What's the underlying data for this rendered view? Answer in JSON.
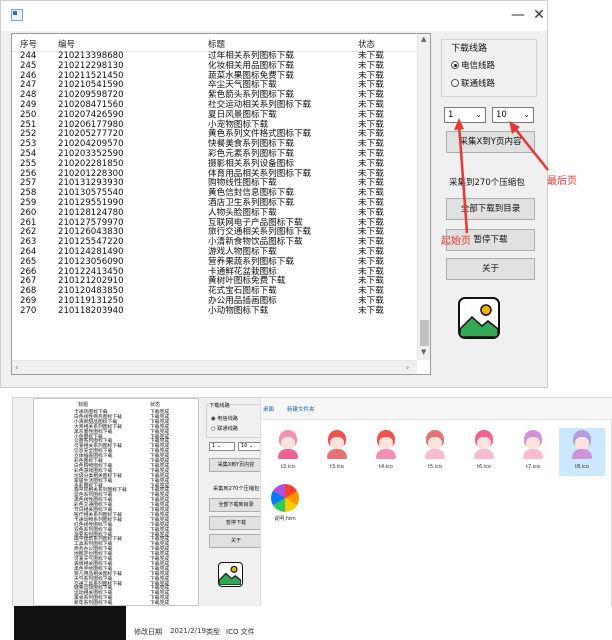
{
  "window": {
    "min_label": "—",
    "close_label": "✕",
    "app_icon": "window-app-icon"
  },
  "list": {
    "headers": {
      "no": "序号",
      "id": "编号",
      "title": "标题",
      "status": "状态"
    },
    "rows": [
      [
        "244",
        "210213398680",
        "过年相关系列图标下载",
        "未下载"
      ],
      [
        "245",
        "210212298130",
        "化妆相关用品图标下载",
        "未下载"
      ],
      [
        "246",
        "210211521450",
        "蔬菜水果图标免费下载",
        "未下载"
      ],
      [
        "247",
        "210210541590",
        "卒尘天气图标下载",
        "未下载"
      ],
      [
        "248",
        "210209598720",
        "紫色箭头系列图标下载",
        "未下载"
      ],
      [
        "249",
        "210208471560",
        "社交运动相关系列图标下载",
        "未下载"
      ],
      [
        "250",
        "210207426590",
        "夏日风景图标下载",
        "未下载"
      ],
      [
        "251",
        "210206177980",
        "小宠物图标下载",
        "未下载"
      ],
      [
        "252",
        "210205277720",
        "黄色系列文件格式图标下载",
        "未下载"
      ],
      [
        "253",
        "210204209570",
        "快餐美食系列图标下载",
        "未下载"
      ],
      [
        "254",
        "210203352590",
        "彩色元素系列图标下载",
        "未下载"
      ],
      [
        "255",
        "210202281850",
        "摄影相关系列设备图标",
        "未下载"
      ],
      [
        "256",
        "210201228300",
        "体育用品相关系列图标下载",
        "未下载"
      ],
      [
        "257",
        "210131293930",
        "购物线性图标下载",
        "未下载"
      ],
      [
        "258",
        "210130575540",
        "黄色信封信息图标下载",
        "未下载"
      ],
      [
        "259",
        "210129551990",
        "酒店卫生系列图标下载",
        "未下载"
      ],
      [
        "260",
        "210128124780",
        "人物头脸图标下载",
        "未下载"
      ],
      [
        "261",
        "210127579970",
        "互联网电子产品图标下载",
        "未下载"
      ],
      [
        "262",
        "210126043830",
        "旅行交通相关系列图标下载",
        "未下载"
      ],
      [
        "263",
        "210125547220",
        "小清新食物饮品图标下载",
        "未下载"
      ],
      [
        "264",
        "210124281490",
        "游戏人物图标下载",
        "未下载"
      ],
      [
        "265",
        "210123056090",
        "营养果蔬系列图标下载",
        "未下载"
      ],
      [
        "266",
        "210122413450",
        "卡通鲜花盆栽图标",
        "未下载"
      ],
      [
        "267",
        "210121202910",
        "黄树叶图标免费下载",
        "未下载"
      ],
      [
        "268",
        "210120483850",
        "花式宝石图标下载",
        "未下载"
      ],
      [
        "269",
        "210119131250",
        "办公用品插画图标",
        "未下载"
      ],
      [
        "270",
        "210118203940",
        "小动物图标下载",
        "未下载"
      ]
    ]
  },
  "panel": {
    "group_title": "下载线路",
    "radio_telecom": "电信线路",
    "radio_unicom": "联通线路",
    "start_page": "1",
    "end_page": "10",
    "collect_button": "采集X到Y页内容",
    "status_text": "采集到270个压缩包",
    "download_button": "全部下载到目录",
    "pause_button": "暂停下载",
    "about_button": "关于"
  },
  "annotations": {
    "end_page": "最后页",
    "start_page": "起始页",
    "color": "#e53935"
  },
  "mini": {
    "headers": {
      "title": "标题",
      "status": "状态"
    },
    "rows": [
      [
        "卡通风图标下载",
        "下载完成"
      ],
      [
        "白色线性商务图标下载",
        "下载完成"
      ],
      [
        "小清新甜品图标下载",
        "下载完成"
      ],
      [
        "大青相关系列图标下载",
        "下载完成"
      ],
      [
        "黑灰面性图标下载",
        "下载完成"
      ],
      [
        "小鱼图标下载",
        "下载完成"
      ],
      [
        "公益系列图标下载",
        "下载完成"
      ],
      [
        "可爱相关系列图标下载",
        "下载完成"
      ],
      [
        "信息安全图标下载",
        "下载完成"
      ],
      [
        "立体插画图标下载",
        "下载完成"
      ],
      [
        "彩色图标下载",
        "下载完成"
      ],
      [
        "白色购物图标下载",
        "下载完成"
      ],
      [
        "彩色游戏图标下载",
        "下载完成"
      ],
      [
        "垃圾分类相关图标下载",
        "下载完成"
      ],
      [
        "家居生活图标下载",
        "下载完成"
      ],
      [
        "多彩图标下载",
        "下载完成"
      ],
      [
        "扁平风相关系列图标下载",
        "下载完成"
      ],
      [
        "蓝色系列图标下载",
        "下载完成"
      ],
      [
        "黑色线性图标下载",
        "下载完成"
      ],
      [
        "彩色交通图标下载",
        "下载完成"
      ],
      [
        "节日相关图标下载",
        "下载完成"
      ],
      [
        "医疗相关系列图标下载",
        "下载完成"
      ],
      [
        "卡通动物系列图标下载",
        "下载完成"
      ],
      [
        "红色线性图标下载",
        "下载完成"
      ],
      [
        "双色系列图标下载",
        "下载完成"
      ],
      [
        "渐变系列图标下载",
        "下载完成"
      ],
      [
        "扁平建筑系列图标下载",
        "下载完成"
      ],
      [
        "工具系列图标下载",
        "下载完成"
      ],
      [
        "商务办公图标下载",
        "下载完成"
      ],
      [
        "地图定位图标下载",
        "下载完成"
      ],
      [
        "可爱天气图标下载",
        "下载完成"
      ],
      [
        "表情相关图标下载",
        "下载完成"
      ],
      [
        "黑色手绘图标下载",
        "下载完成"
      ],
      [
        "婴儿用品相关图标下载",
        "下载完成"
      ],
      [
        "天气系列图标下载",
        "下载完成"
      ],
      [
        "交通工具系列图标下载",
        "下载完成"
      ],
      [
        "健身运动图标下载",
        "下载完成"
      ],
      [
        "运动相关图标下载",
        "下载完成"
      ],
      [
        "美食系列图标下载",
        "下载完成"
      ],
      [
        "新年系列图标下载",
        "下载完成"
      ]
    ],
    "group_title": "下载线路",
    "radio_telecom": "电信线路",
    "radio_unicom": "联通线路",
    "start_page": "1",
    "end_page": "10",
    "collect_button": "采集X到Y页内容",
    "status_text": "采集到270个压缩包",
    "download_button": "全部下载到目录",
    "pause_button": "暂停下载",
    "about_button": "关于"
  },
  "explorer": {
    "crumb_1": "桌面",
    "crumb_2": "新建文件夹",
    "files": [
      {
        "name": "t2.ico",
        "hair": "#f48fb1",
        "body": "#f06292"
      },
      {
        "name": "t3.ico",
        "hair": "#ef5350",
        "body": "#e57373"
      },
      {
        "name": "t4.ico",
        "hair": "#ef5350",
        "body": "#f48fb1"
      },
      {
        "name": "t5.ico",
        "hair": "#e57373",
        "body": "#f8bbd0"
      },
      {
        "name": "t6.ico",
        "hair": "#f06292",
        "body": "#f8bbd0"
      },
      {
        "name": "t7.ico",
        "hair": "#ce93d8",
        "body": "#f8bbd0"
      },
      {
        "name": "t8.ico",
        "hair": "#b39ddb",
        "body": "#ce93d8"
      }
    ],
    "html_file": "说明.htm"
  },
  "taskbar": {
    "items": [
      "修改日期",
      "2021/2/19",
      "类型",
      "ICO 文件"
    ]
  }
}
